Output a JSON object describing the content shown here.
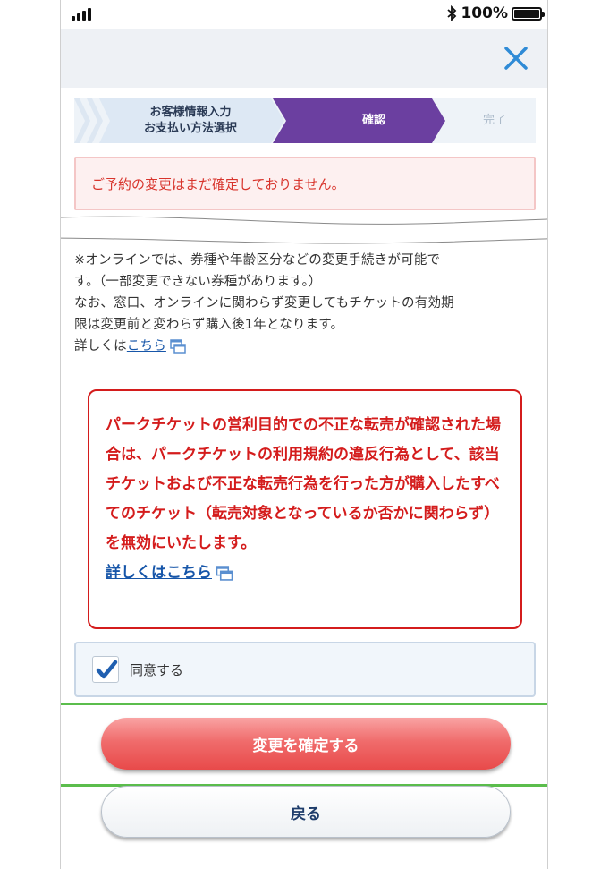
{
  "status_bar": {
    "battery_percent": "100%",
    "battery_level": 1.0
  },
  "nav": {
    "close_icon": "close-icon"
  },
  "steps": [
    {
      "label_line1": "お客様情報入力",
      "label_line2": "お支払い方法選択"
    },
    {
      "label": "確認"
    },
    {
      "label": "完了"
    }
  ],
  "notice": {
    "text": "ご予約の変更はまだ確定しておりません。"
  },
  "body": {
    "line1": "※オンラインでは、券種や年齢区分などの変更手続きが可能で",
    "line2": "す。（一部変更できない券種があります。）",
    "line3": "なお、窓口、オンラインに関わらず変更してもチケットの有効期",
    "line4": "限は変更前と変わらず購入後1年となります。",
    "details_prefix": "詳しくは",
    "details_link": "こちら"
  },
  "warning": {
    "text": "パークチケットの営利目的での不正な転売が確認された場合は、パークチケットの利用規約の違反行為として、該当チケットおよび不正な転売行為を行った方が購入したすべてのチケット（転売対象となっているか否かに関わらず）を無効にいたします。",
    "link": "詳しくはこちら"
  },
  "agree": {
    "label": "同意する",
    "checked": true
  },
  "buttons": {
    "confirm": "変更を確定する",
    "back": "戻る"
  },
  "colors": {
    "accent_purple": "#6b3fa0",
    "warning_red": "#d41c1c",
    "link_blue": "#1756a9",
    "confirm_red": "#f06c6c",
    "highlight_green": "#5bbd4c"
  }
}
